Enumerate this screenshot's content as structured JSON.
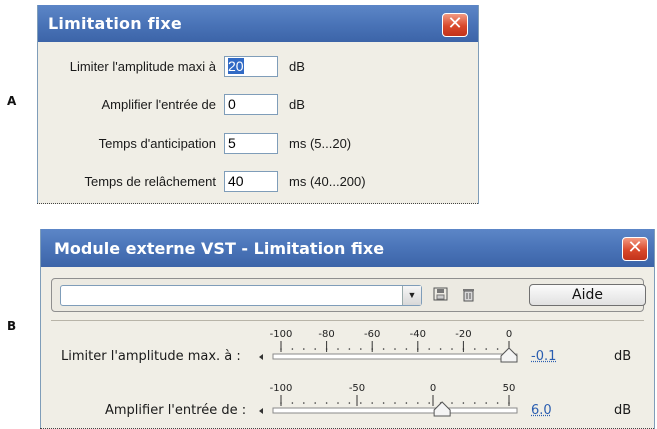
{
  "markers": {
    "a": "A",
    "b": "B"
  },
  "window_a": {
    "title": "Limitation fixe",
    "close_glyph": "✕",
    "rows": [
      {
        "label": "Limiter l'amplitude maxi à",
        "value": "20",
        "unit": "dB",
        "selected": true
      },
      {
        "label": "Amplifier l'entrée de",
        "value": "0",
        "unit": "dB"
      },
      {
        "label": "Temps d'anticipation",
        "value": "5",
        "unit": "ms (5...20)"
      },
      {
        "label": "Temps de relâchement",
        "value": "40",
        "unit": "ms (40...200)"
      }
    ]
  },
  "window_b": {
    "title": "Module externe VST - Limitation fixe",
    "close_glyph": "✕",
    "preset_value": "",
    "icons": [
      "save-preset-icon",
      "delete-preset-icon"
    ],
    "help_button": "Aide",
    "params": [
      {
        "label": "Limiter l'amplitude max. à :",
        "ticks": [
          "-100",
          "-80",
          "-60",
          "-40",
          "-20",
          "0"
        ],
        "min": -100,
        "max": 0,
        "thumb": 0,
        "value": "-0.1",
        "unit": "dB"
      },
      {
        "label": "Amplifier l'entrée de :",
        "ticks": [
          "-100",
          "-50",
          "0",
          "50"
        ],
        "min": -100,
        "max": 50,
        "thumb": 6,
        "value": "6.0",
        "unit": "dB"
      }
    ]
  }
}
